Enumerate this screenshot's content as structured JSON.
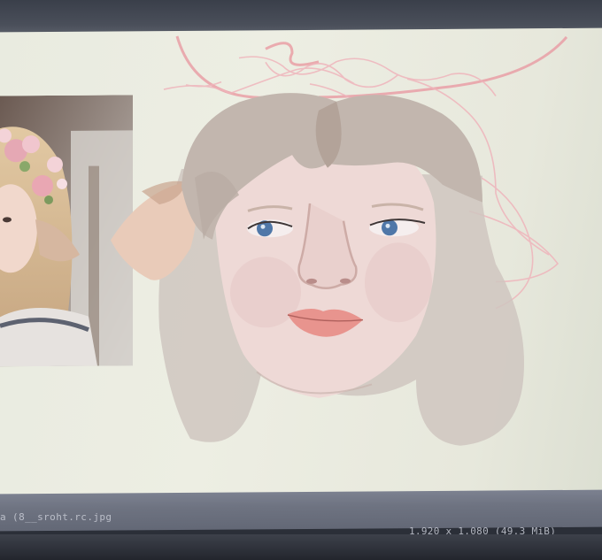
{
  "status": {
    "file_label": "a (8__sroht.rc.jpg",
    "dimensions": "1,920 x 1,080 (49.3 MiB)"
  },
  "colors": {
    "canvas": "#ebece1",
    "hair": "#c2b6ae",
    "skin": "#eed9d6",
    "eyes": "#4f77a8",
    "lips": "#e8948e",
    "sketch_lines": "#e99aa2",
    "statusbar": "#6e7381"
  }
}
